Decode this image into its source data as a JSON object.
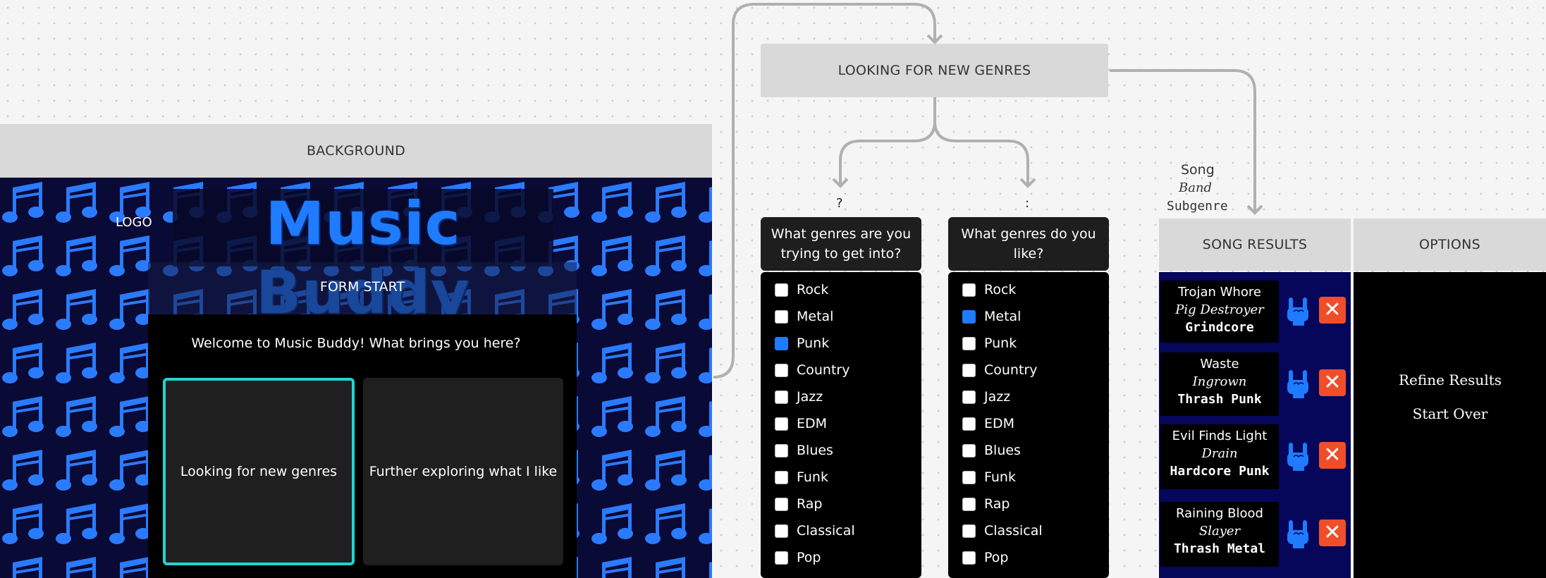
{
  "sections": {
    "background": "BACKGROUND",
    "looking_for_new_genres": "LOOKING FOR NEW GENRES",
    "song_results": "SONG RESULTS",
    "options": "OPTIONS"
  },
  "music_buddy": {
    "logo_label": "LOGO",
    "logo_title": "Music Buddy",
    "form_start_label": "FORM START",
    "welcome": "Welcome to Music Buddy! What brings you here?",
    "choices": [
      "Looking for new genres",
      "Further exploring what I like"
    ]
  },
  "genres": {
    "left_marker": "?",
    "right_marker": ":",
    "left_question": "What genres are you trying to get into?",
    "right_question": "What genres do you like?",
    "items": [
      "Rock",
      "Metal",
      "Punk",
      "Country",
      "Jazz",
      "EDM",
      "Blues",
      "Funk",
      "Rap",
      "Classical",
      "Pop"
    ],
    "left_selected": [
      "Punk"
    ],
    "right_selected": [
      "Metal"
    ]
  },
  "song_legend": {
    "song": "Song",
    "band": "Band",
    "subgenre": "Subgenre"
  },
  "songs": [
    {
      "title": "Trojan Whore",
      "band": "Pig Destroyer",
      "subgenre": "Grindcore"
    },
    {
      "title": "Waste",
      "band": "Ingrown",
      "subgenre": "Thrash Punk"
    },
    {
      "title": "Evil Finds Light",
      "band": "Drain",
      "subgenre": "Hardcore Punk"
    },
    {
      "title": "Raining Blood",
      "band": "Slayer",
      "subgenre": "Thrash Metal"
    }
  ],
  "options": {
    "refine": "Refine Results",
    "start_over": "Start Over"
  },
  "colors": {
    "accent": "#1f7bff",
    "selection": "#22d3d3",
    "remove": "#f04e2a",
    "results_bg": "#06065a"
  }
}
